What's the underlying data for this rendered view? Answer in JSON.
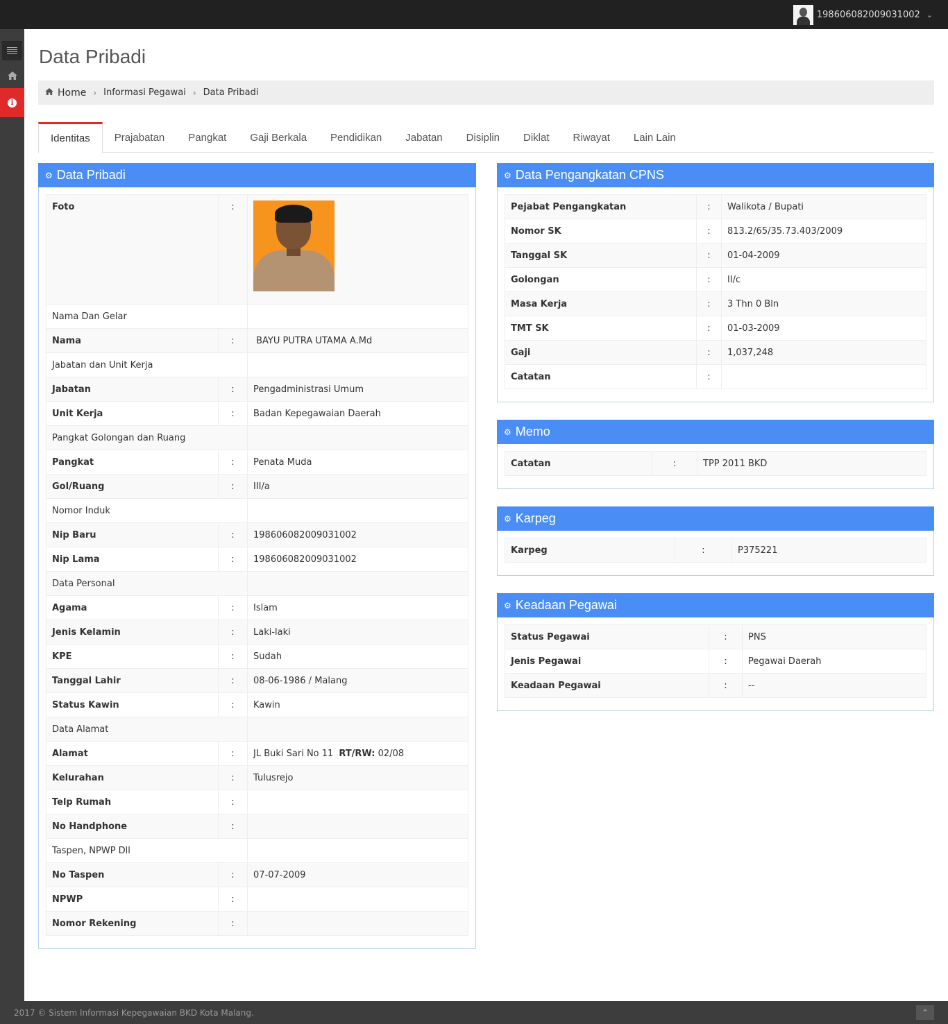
{
  "topbar": {
    "username": "198606082009031002"
  },
  "page": {
    "title": "Data Pribadi"
  },
  "breadcrumb": {
    "home": "Home",
    "level2": "Informasi Pegawai",
    "current": "Data Pribadi"
  },
  "tabs": [
    "Identitas",
    "Prajabatan",
    "Pangkat",
    "Gaji Berkala",
    "Pendidikan",
    "Jabatan",
    "Disiplin",
    "Diklat",
    "Riwayat",
    "Lain Lain"
  ],
  "data_pribadi": {
    "title": "Data Pribadi",
    "foto_label": "Foto",
    "colon": ":",
    "rows": [
      {
        "section": "Nama Dan Gelar"
      },
      {
        "label": "Nama",
        "value": " BAYU PUTRA UTAMA A.Md"
      },
      {
        "section": "Jabatan dan Unit Kerja"
      },
      {
        "label": "Jabatan",
        "value": "Pengadministrasi Umum"
      },
      {
        "label": "Unit Kerja",
        "value": "Badan Kepegawaian Daerah"
      },
      {
        "section": "Pangkat Golongan dan Ruang"
      },
      {
        "label": "Pangkat",
        "value": "Penata Muda"
      },
      {
        "label": "Gol/Ruang",
        "value": "III/a"
      },
      {
        "section": "Nomor Induk"
      },
      {
        "label": "Nip Baru",
        "value": "198606082009031002"
      },
      {
        "label": "Nip Lama",
        "value": "198606082009031002"
      },
      {
        "section": "Data Personal"
      },
      {
        "label": "Agama",
        "value": "Islam"
      },
      {
        "label": "Jenis Kelamin",
        "value": "Laki-laki"
      },
      {
        "label": "KPE",
        "value": "Sudah"
      },
      {
        "label": "Tanggal Lahir",
        "value": "08-06-1986 / Malang"
      },
      {
        "label": "Status Kawin",
        "value": "Kawin"
      },
      {
        "section": "Data Alamat"
      },
      {
        "label": "Alamat",
        "value": "JL Buki Sari No 11",
        "extra_label": "RT/RW:",
        "extra_value": " 02/08"
      },
      {
        "label": "Kelurahan",
        "value": "Tulusrejo"
      },
      {
        "label": "Telp Rumah",
        "value": ""
      },
      {
        "label": "No Handphone",
        "value": ""
      },
      {
        "section": "Taspen, NPWP Dll"
      },
      {
        "label": "No Taspen",
        "value": "07-07-2009"
      },
      {
        "label": "NPWP",
        "value": ""
      },
      {
        "label": "Nomor Rekening",
        "value": ""
      }
    ]
  },
  "cpns": {
    "title": "Data Pengangkatan CPNS",
    "rows": [
      {
        "label": "Pejabat Pengangkatan",
        "value": "Walikota / Bupati"
      },
      {
        "label": "Nomor SK",
        "value": "813.2/65/35.73.403/2009"
      },
      {
        "label": "Tanggal SK",
        "value": "01-04-2009"
      },
      {
        "label": "Golongan",
        "value": "II/c"
      },
      {
        "label": "Masa Kerja",
        "value": "3 Thn 0 Bln"
      },
      {
        "label": "TMT SK",
        "value": "01-03-2009"
      },
      {
        "label": "Gaji",
        "value": "1,037,248"
      },
      {
        "label": "Catatan",
        "value": ""
      }
    ]
  },
  "memo": {
    "title": "Memo",
    "rows": [
      {
        "label": "Catatan",
        "value": "TPP 2011 BKD"
      }
    ]
  },
  "karpeg": {
    "title": "Karpeg",
    "rows": [
      {
        "label": "Karpeg",
        "value": "P375221"
      }
    ]
  },
  "keadaan": {
    "title": "Keadaan Pegawai",
    "rows": [
      {
        "label": "Status Pegawai",
        "value": "PNS"
      },
      {
        "label": "Jenis Pegawai",
        "value": "Pegawai Daerah"
      },
      {
        "label": "Keadaan Pegawai",
        "value": "--"
      }
    ]
  },
  "footer": {
    "text": "2017 © Sistem Informasi Kepegawaian BKD Kota Malang."
  },
  "colors": {
    "accent": "#e02a2a",
    "panel_header": "#4a8ef5",
    "topbar": "#212121"
  }
}
